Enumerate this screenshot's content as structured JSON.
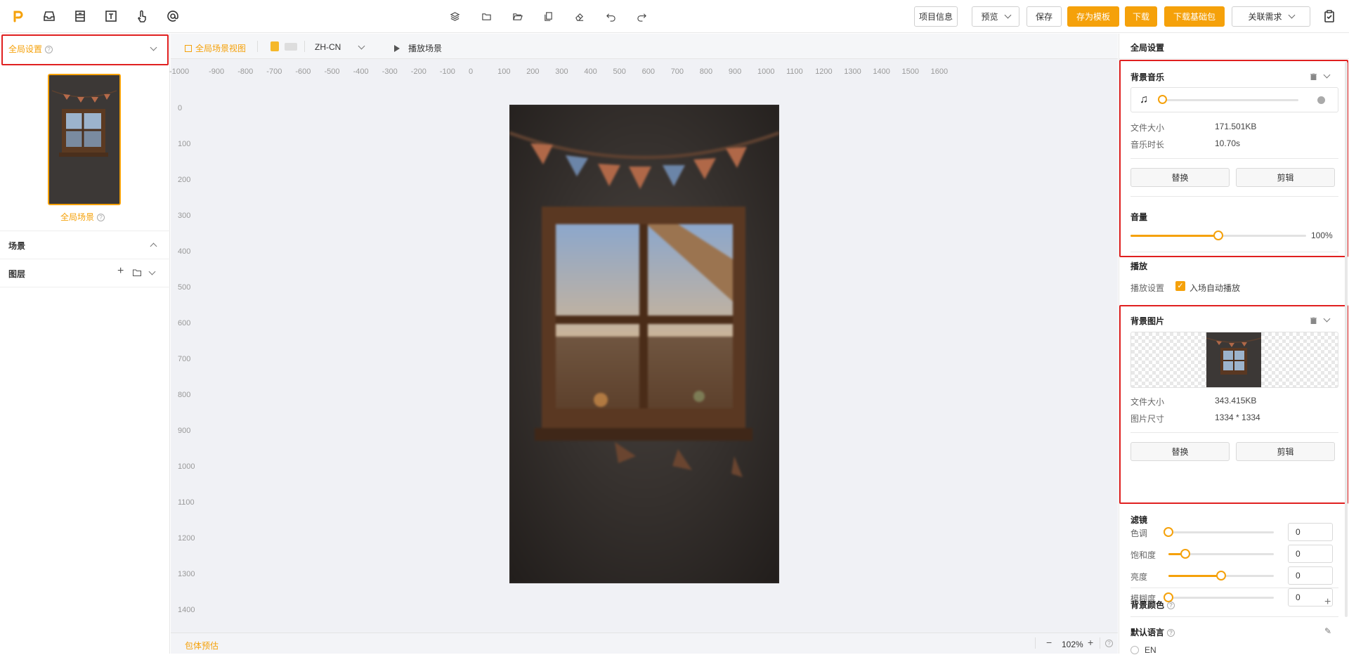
{
  "topbar": {
    "left_icons": [
      "logo-icon",
      "inbox-icon",
      "template-icon",
      "text-icon",
      "gesture-icon",
      "at-icon"
    ],
    "mid_icons": [
      "layers-icon",
      "folder-icon",
      "folder-open-icon",
      "copy-icon",
      "erase-icon",
      "undo-icon",
      "redo-icon"
    ],
    "project_info": "项目信息",
    "preview": "预览",
    "save": "保存",
    "save_template": "存为模板",
    "download": "下载",
    "download_base": "下载基础包",
    "related_requirements": "关联需求",
    "accent": "#f5a10a"
  },
  "left": {
    "global_settings": "全局设置",
    "global_scene": "全局场景",
    "scene": "场景",
    "layers": "图层"
  },
  "canvas": {
    "global_scene_view": "全局场景视图",
    "language": "ZH-CN",
    "play_scene": "播放场景",
    "ruler_top": [
      "-1000",
      "-900",
      "-800",
      "-700",
      "-600",
      "-500",
      "-400",
      "-300",
      "-200",
      "-100",
      "0",
      "100",
      "200",
      "300",
      "400",
      "500",
      "600",
      "700",
      "800",
      "900",
      "1000",
      "1100",
      "1200",
      "1300",
      "1400",
      "1500",
      "1600"
    ],
    "ruler_left": [
      "0",
      "100",
      "200",
      "300",
      "400",
      "500",
      "600",
      "700",
      "800",
      "900",
      "1000",
      "1100",
      "1200",
      "1300",
      "1400"
    ],
    "package_estimate": "包体预估",
    "zoom": "102%",
    "zoom_minus": "−",
    "zoom_plus": "+"
  },
  "right": {
    "header": "全局设置",
    "bg_music": {
      "title": "背景音乐",
      "file_size_label": "文件大小",
      "file_size": "171.501KB",
      "duration_label": "音乐时长",
      "duration": "10.70s",
      "replace": "替换",
      "edit": "剪辑",
      "volume_label": "音量",
      "volume": "100%",
      "volume_level": 0.5,
      "play_title": "播放",
      "play_setting_label": "播放设置",
      "autoplay_label": "入场自动播放"
    },
    "bg_image": {
      "title": "背景图片",
      "file_size_label": "文件大小",
      "file_size": "343.415KB",
      "dims_label": "图片尺寸",
      "dims": "1334 * 1334",
      "replace": "替换",
      "edit": "剪辑"
    },
    "filter": {
      "title": "滤镜",
      "rows": [
        {
          "label": "色调",
          "value": "0",
          "level": 0.0
        },
        {
          "label": "饱和度",
          "value": "0",
          "level": 0.16
        },
        {
          "label": "亮度",
          "value": "0",
          "level": 0.5
        },
        {
          "label": "模糊度",
          "value": "0",
          "level": 0.0
        }
      ]
    },
    "bg_color": "背景颜色",
    "default_language": "默认语言",
    "lang_option": "EN"
  }
}
